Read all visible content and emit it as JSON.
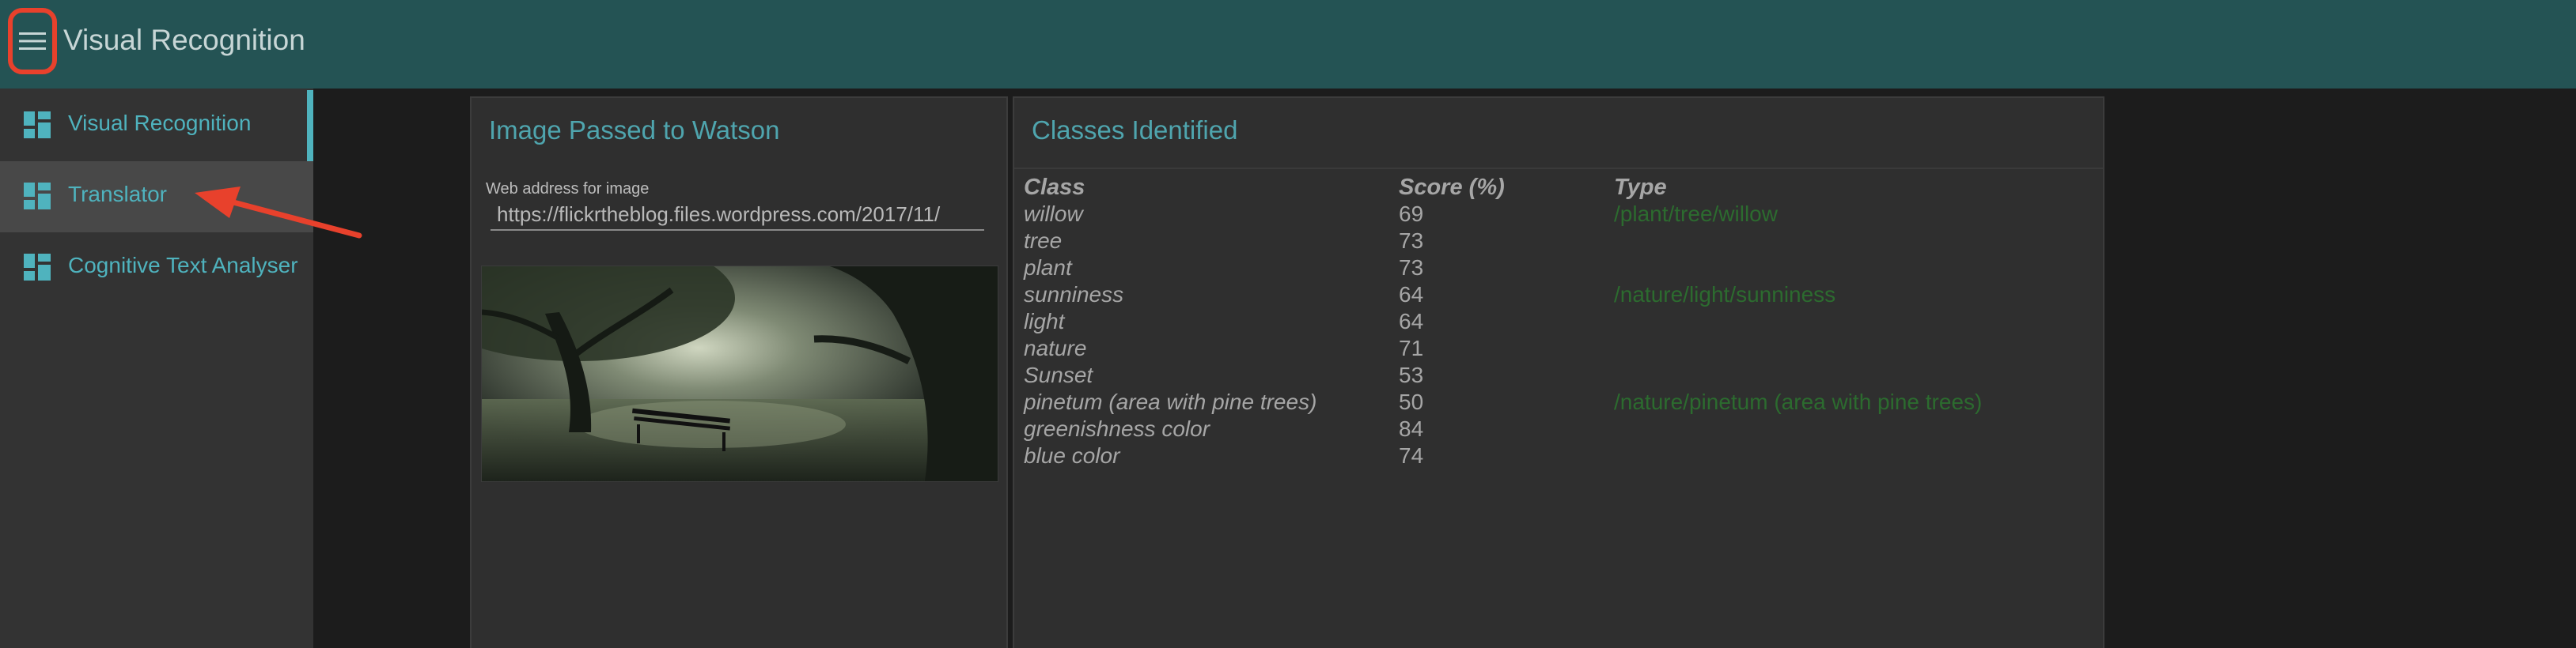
{
  "header": {
    "title": "Visual Recognition",
    "menu_icon": "hamburger-menu-icon",
    "annotation_color": "#e8412c"
  },
  "sidebar": {
    "items": [
      {
        "label": "Visual Recognition",
        "icon": "dashboard-icon",
        "active": true
      },
      {
        "label": "Translator",
        "icon": "dashboard-icon",
        "highlighted": true
      },
      {
        "label": "Cognitive Text Analyser",
        "icon": "dashboard-icon"
      }
    ]
  },
  "image_panel": {
    "title": "Image Passed to Watson",
    "field_label": "Web address for image",
    "field_value": "https://flickrtheblog.files.wordpress.com/2017/11/"
  },
  "classes_panel": {
    "title": "Classes Identified",
    "headers": {
      "class": "Class",
      "score": "Score (%)",
      "type": "Type"
    },
    "rows": [
      {
        "class": "willow",
        "score": "69",
        "type": "/plant/tree/willow"
      },
      {
        "class": "tree",
        "score": "73",
        "type": ""
      },
      {
        "class": "plant",
        "score": "73",
        "type": ""
      },
      {
        "class": "sunniness",
        "score": "64",
        "type": "/nature/light/sunniness"
      },
      {
        "class": "light",
        "score": "64",
        "type": ""
      },
      {
        "class": "nature",
        "score": "71",
        "type": ""
      },
      {
        "class": "Sunset",
        "score": "53",
        "type": ""
      },
      {
        "class": "pinetum (area with pine trees)",
        "score": "50",
        "type": "/nature/pinetum (area with pine trees)"
      },
      {
        "class": "greenishness color",
        "score": "84",
        "type": ""
      },
      {
        "class": "blue color",
        "score": "74",
        "type": ""
      }
    ]
  },
  "colors": {
    "topbar": "#245354",
    "accent": "#4fb3be",
    "type_text": "#2c6b2f"
  }
}
